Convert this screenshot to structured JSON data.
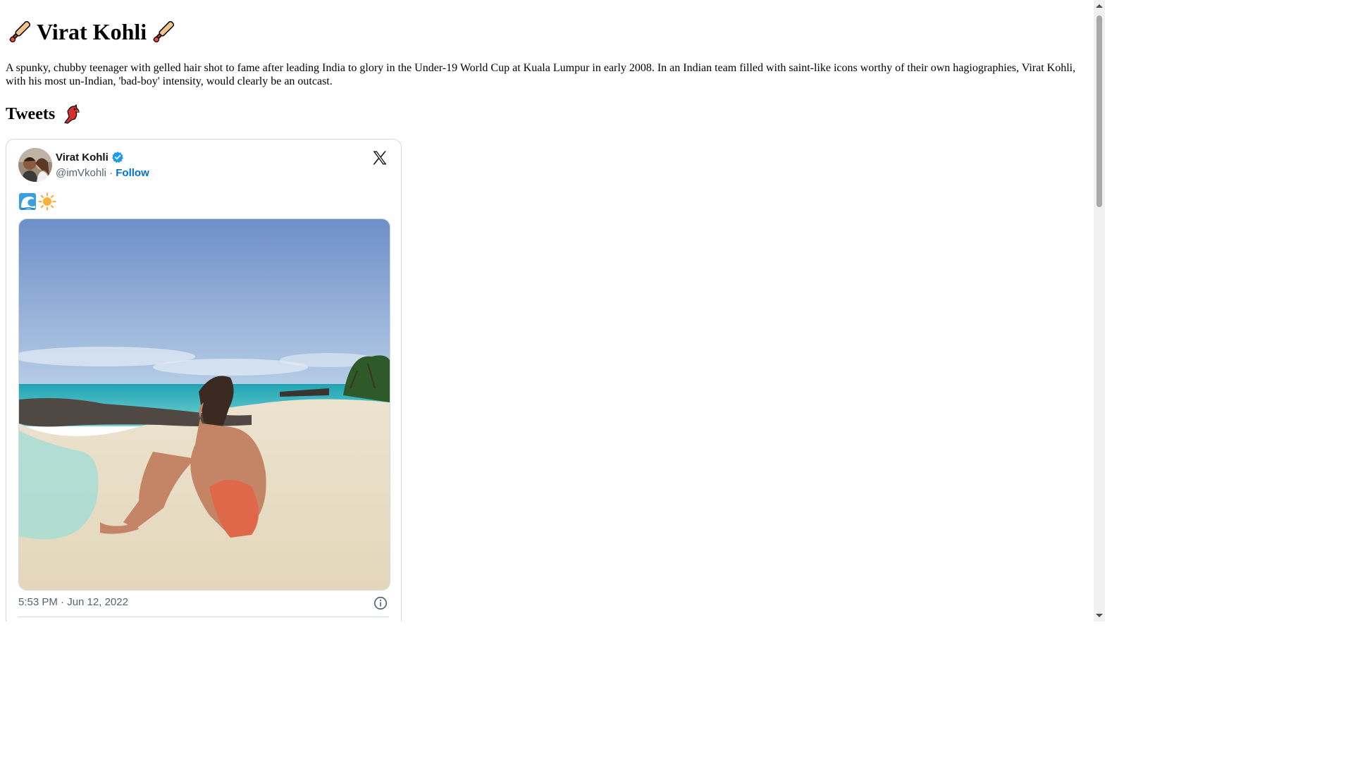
{
  "page": {
    "title": "Virat Kohli",
    "title_icon": "cricket-bat-icon",
    "intro": "A spunky, chubby teenager with gelled hair shot to fame after leading India to glory in the Under-19 World Cup at Kuala Lumpur in early 2008. In an Indian team filled with saint-like icons worthy of their own hagiographies, Virat Kohli, with his most un-Indian, 'bad-boy' intensity, would clearly be an outcast.",
    "section_heading": "Tweets",
    "section_icon": "red-bird-icon"
  },
  "tweet": {
    "author_name": "Virat Kohli",
    "verified_icon": "verified-badge-icon",
    "handle": "@imVkohli",
    "separator": "·",
    "follow_label": "Follow",
    "text_emojis": [
      "wave-emoji",
      "sun-emoji"
    ],
    "photo": "beach-photo",
    "timestamp": "5:53 PM · Jun 12, 2022",
    "brand_icon": "x-logo-icon",
    "info_icon": "info-icon"
  },
  "colors": {
    "follow_link": "#006fd6",
    "verified_badge": "#1d9bf0",
    "muted_text": "#536471",
    "card_border": "#cfd9de"
  }
}
